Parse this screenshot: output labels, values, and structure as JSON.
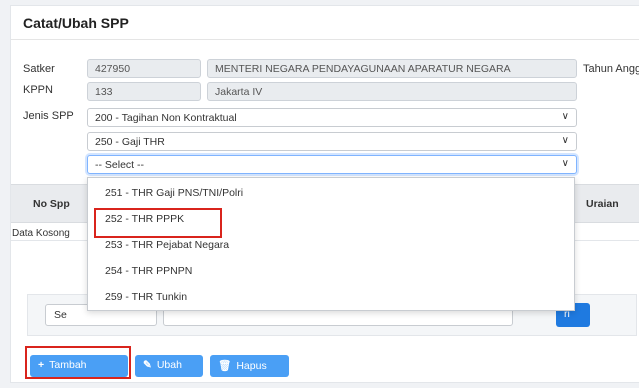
{
  "header": {
    "title": "Catat/Ubah SPP"
  },
  "form": {
    "satker": {
      "label": "Satker",
      "code": "427950",
      "name": "MENTERI NEGARA PENDAYAGUNAAN APARATUR NEGARA"
    },
    "kppn": {
      "label": "KPPN",
      "code": "133",
      "name": "Jakarta IV"
    },
    "tahun_label": "Tahun Angg",
    "jenis_spp": {
      "label": "Jenis SPP",
      "select1": "200 - Tagihan Non Kontraktual",
      "select2": "250 - Gaji THR",
      "select3": "-- Select --"
    }
  },
  "table": {
    "columns": {
      "no_spp": "No Spp",
      "uraian": "Uraian"
    },
    "empty_text": "Data Kosong"
  },
  "dropdown": {
    "options": [
      "251 - THR Gaji PNS/TNI/Polri",
      "252 - THR PPPK",
      "253 - THR Pejabat Negara",
      "254 - THR PPNPN",
      "259 - THR Tunkin"
    ],
    "highlighted": "252 - THR PPPK"
  },
  "pager": {
    "left_text": "Se",
    "button_text": "ri"
  },
  "toolbar": {
    "tambah": "Tambah",
    "ubah": "Ubah",
    "hapus": "Hapus"
  },
  "colors": {
    "accent": "#4a9ff5",
    "highlight": "#d9241c",
    "primary": "#1f7ae0"
  },
  "icons": {
    "tambah": "plus-icon",
    "ubah": "edit-icon",
    "hapus": "trash-icon",
    "select": "chevron-down-icon"
  }
}
